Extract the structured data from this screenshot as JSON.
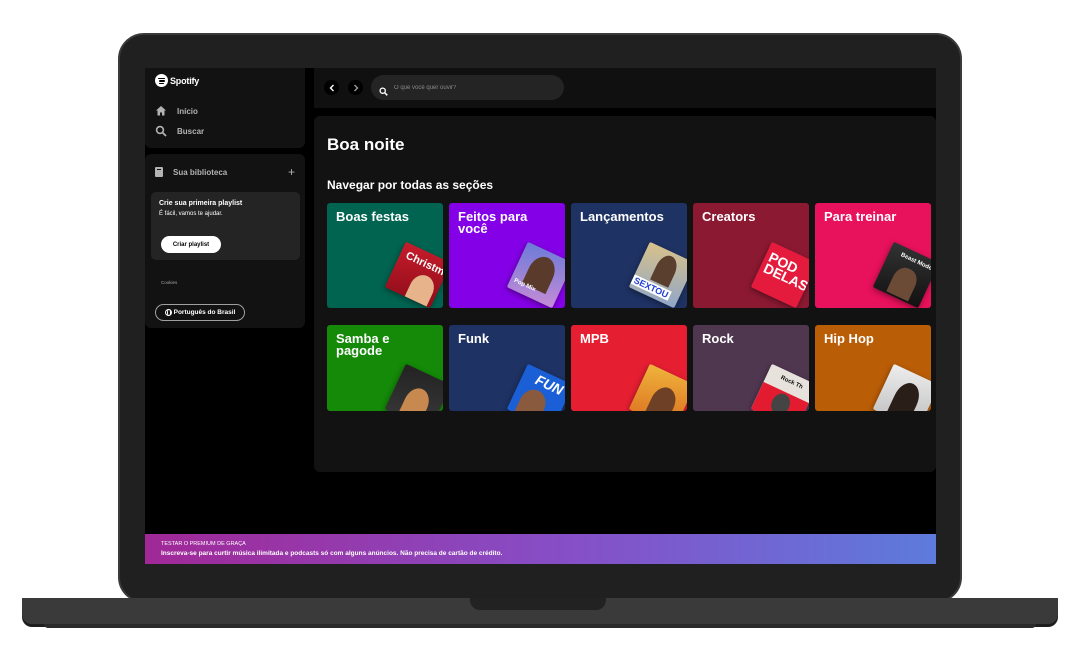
{
  "app": {
    "name": "Spotify"
  },
  "sidebar": {
    "nav": [
      {
        "label": "Início",
        "icon": "home-icon"
      },
      {
        "label": "Buscar",
        "icon": "search-icon"
      }
    ],
    "library": {
      "title": "Sua biblioteca",
      "add_icon": "plus-icon",
      "playlist_card": {
        "title": "Crie sua primeira playlist",
        "subtitle": "É fácil, vamos te ajudar.",
        "button_label": "Criar playlist"
      },
      "cookies_label": "Cookies",
      "language_button": "Português do Brasil"
    }
  },
  "topbar": {
    "back_icon": "chevron-left-icon",
    "forward_icon": "chevron-right-icon",
    "search_placeholder": "O que você quer ouvir?"
  },
  "main": {
    "greeting": "Boa noite",
    "section_title": "Navegar por todas as seções",
    "categories": [
      {
        "label": "Boas festas",
        "color": "#006450",
        "art_text": "Christm Hi"
      },
      {
        "label": "Feitos para você",
        "color": "#8400e7",
        "art_text": "Pop Mix"
      },
      {
        "label": "Lançamentos",
        "color": "#1e3264",
        "art_text": "SEXTOU"
      },
      {
        "label": "Creators",
        "color": "#8c1932",
        "art_text": "POD DELAS"
      },
      {
        "label": "Para treinar",
        "color": "#e8115b",
        "art_text": "Beast Mode"
      },
      {
        "label": "Samba e pagode",
        "color": "#148a08",
        "art_text": ""
      },
      {
        "label": "Funk",
        "color": "#1e3264",
        "art_text": "FUN"
      },
      {
        "label": "MPB",
        "color": "#e61e32",
        "art_text": ""
      },
      {
        "label": "Rock",
        "color": "#503750",
        "art_text": "Rock Th"
      },
      {
        "label": "Hip Hop",
        "color": "#ba5d07",
        "art_text": ""
      }
    ]
  },
  "banner": {
    "title": "TESTAR O PREMIUM DE GRAÇA",
    "text": "Inscreva-se para curtir música ilimitada e podcasts só com alguns anúncios. Não precisa de cartão de crédito."
  }
}
